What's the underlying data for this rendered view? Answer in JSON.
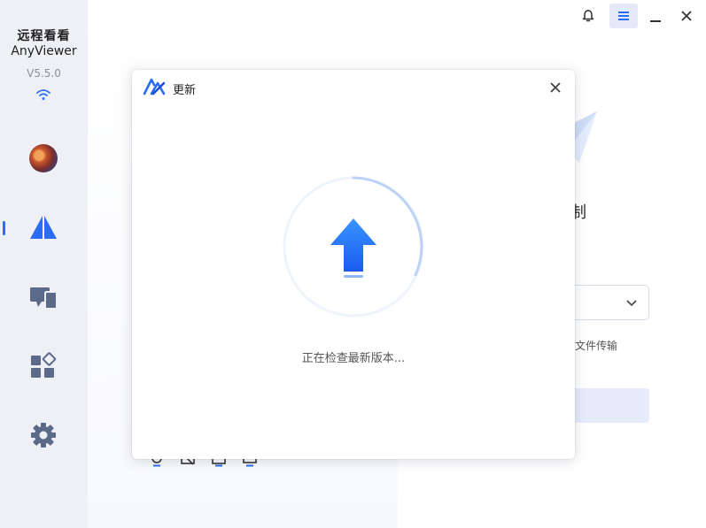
{
  "app": {
    "name_cn": "远程看看",
    "name_en": "AnyViewer",
    "version": "V5.5.0"
  },
  "sidebar": {
    "items": [
      {
        "name": "profile",
        "icon": "avatar"
      },
      {
        "name": "remote-control",
        "icon": "anyviewer-logo-icon",
        "active": true
      },
      {
        "name": "devices",
        "icon": "devices-icon"
      },
      {
        "name": "apps",
        "icon": "apps-icon"
      },
      {
        "name": "settings",
        "icon": "gear-icon"
      }
    ]
  },
  "titlebar": {
    "buttons": [
      "bell-icon",
      "menu-icon",
      "minimize-icon",
      "close-icon"
    ]
  },
  "background": {
    "title_fragment": "制",
    "subtext_fragment": "文件传输"
  },
  "dialog": {
    "title": "更新",
    "status": "正在检查最新版本..."
  },
  "colors": {
    "accent": "#2b6cf6",
    "sidebar_bg": "#eef0f6",
    "icon_gray": "#5c6a8a"
  }
}
